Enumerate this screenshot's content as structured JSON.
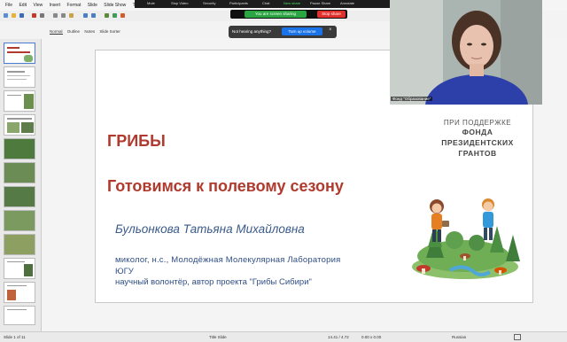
{
  "menu": {
    "items": [
      "File",
      "Edit",
      "View",
      "Insert",
      "Format",
      "Slide",
      "Slide Show",
      "Tools",
      "Windo"
    ]
  },
  "zoom_toolbar": {
    "labels": [
      "Mute",
      "Stop Video",
      "Security",
      "Participants",
      "Chat",
      "New share",
      "Pause Share",
      "Annotate"
    ],
    "sharing_label": "You are screen sharing",
    "stop_share_label": "Stop share"
  },
  "view_tabs": [
    "Normal",
    "Outline",
    "Notes",
    "Slide Sorter"
  ],
  "notification": {
    "text": "Not hearing anything?",
    "button_label": "Turn up volume",
    "close_glyph": "×"
  },
  "slide": {
    "org_line1": "ПРИ ПОДДЕРЖКЕ",
    "org_line2": "ФОНДА",
    "org_line3": "ПРЕЗИДЕНТСКИХ",
    "org_line4": "ГРАНТОВ",
    "title": "ГРИБЫ",
    "subtitle": "Готовимся к полевому сезону",
    "author": "Бульонкова Татьяна Михайловна",
    "affil1": "миколог, н.с., Молодёжная Молекулярная Лаборатория",
    "affil2": "ЮГУ",
    "affil3": "научный волонтёр, автор проекта \"Грибы Сибири\""
  },
  "webcam": {
    "label": "Фонд \"Образование\""
  },
  "statusbar": {
    "slide_count": "Slide 1 of 11",
    "layout": "Title Slide",
    "position": "14.41 / 4.72",
    "size": "0.00 x 0.00",
    "language": "Russian"
  },
  "colors": {
    "title_red": "#b03a2e",
    "author_blue": "#3a5a8a",
    "affil_blue": "#2f4f86",
    "org_gray": "#555555",
    "zoom_green": "#2aa541",
    "stop_red": "#e0302c"
  }
}
